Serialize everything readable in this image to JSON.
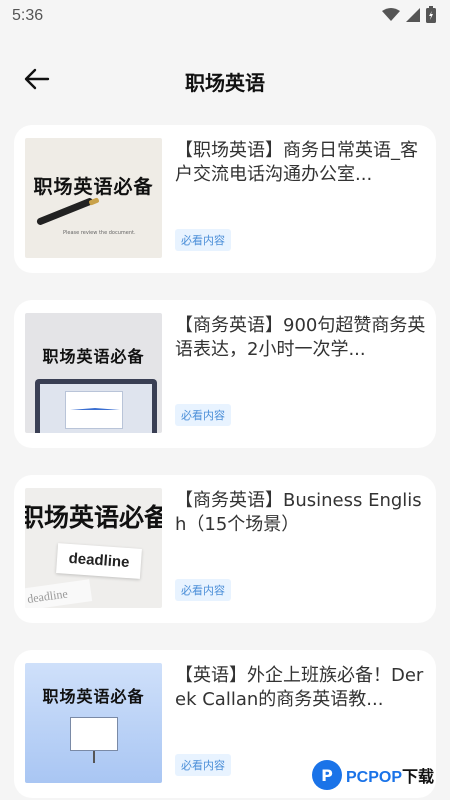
{
  "status_bar": {
    "time": "5:36",
    "icons": [
      "wifi-icon",
      "signal-icon",
      "battery-icon"
    ]
  },
  "header": {
    "title": "职场英语",
    "back_icon": "arrow-left-icon"
  },
  "cards": [
    {
      "title": "【职场英语】商务日常英语_客户交流电话沟通办公室...",
      "tag": "必看内容",
      "thumb_text": "职场英语必备",
      "thumb_caption": "Please review the document."
    },
    {
      "title": "【商务英语】900句超赞商务英语表达，2小时一次学...",
      "tag": "必看内容",
      "thumb_text": "职场英语必备"
    },
    {
      "title": "【商务英语】Business English（15个场景）",
      "tag": "必看内容",
      "thumb_text": "职场英语必备",
      "thumb_word": "deadline",
      "thumb_word2": "deadline"
    },
    {
      "title": "【英语】外企上班族必备！Derek Callan的商务英语教...",
      "tag": "必看内容",
      "thumb_text": "职场英语必备"
    }
  ],
  "watermark": {
    "logo_letter": "P",
    "brand": "PCPOP",
    "suffix": "下载"
  },
  "colors": {
    "background": "#f5f5f5",
    "card": "#ffffff",
    "tag_bg": "#e8f3ff",
    "tag_text": "#4a8ed8",
    "watermark": "#1a73e8"
  }
}
